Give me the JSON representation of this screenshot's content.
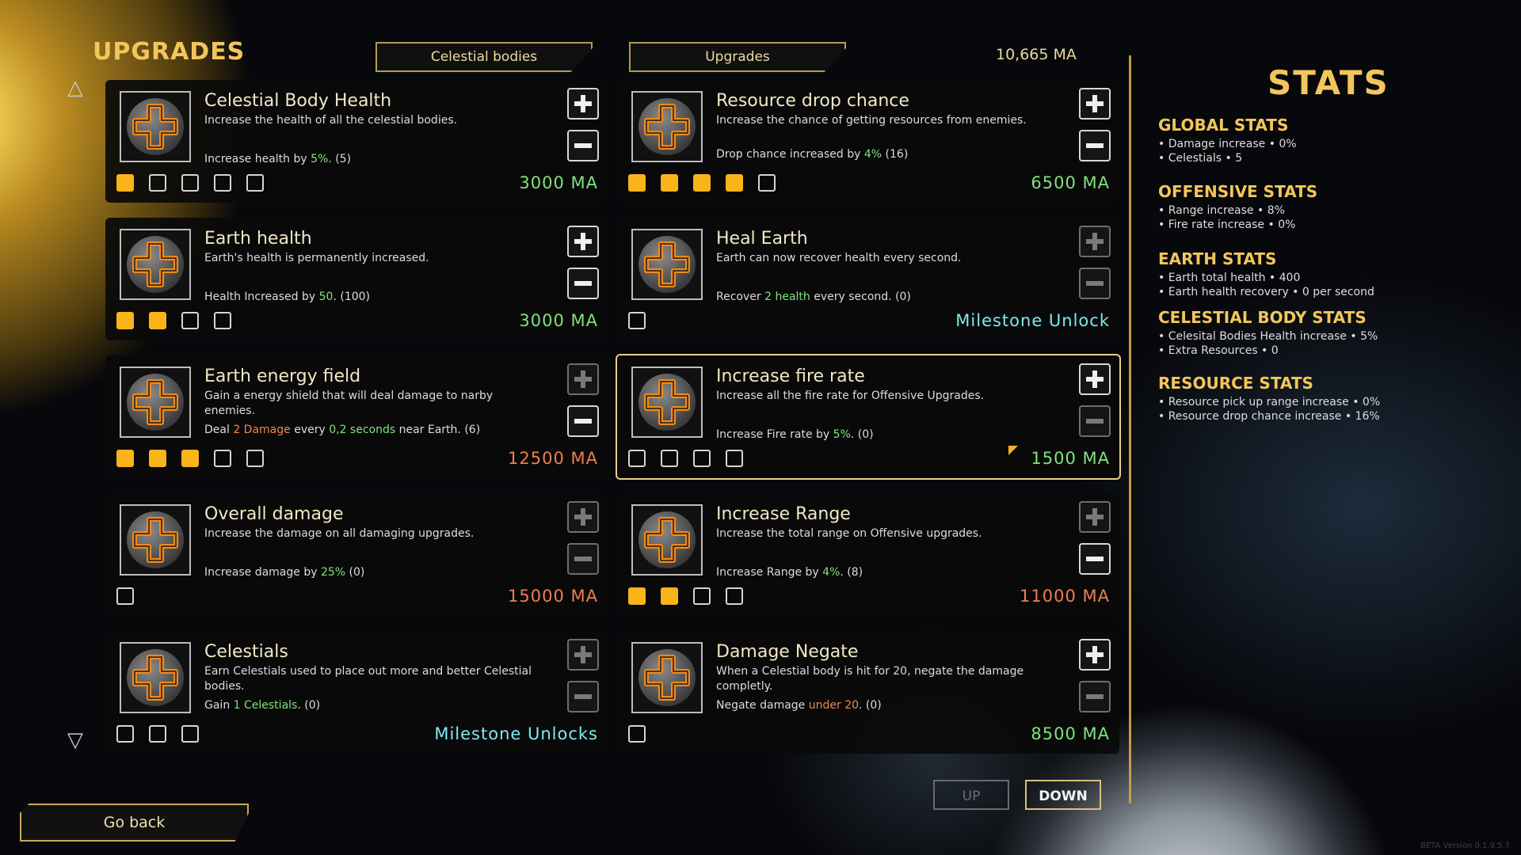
{
  "header": {
    "title": "UPGRADES",
    "tab_celestial": "Celestial bodies",
    "tab_upgrades": "Upgrades",
    "currency": "10,665 MA"
  },
  "cards": [
    {
      "name": "Celestial Body Health",
      "desc": "Increase the health of all the celestial bodies.",
      "det_pre": "Increase health by ",
      "det_hl": "5%",
      "det_post": ". (5)",
      "hl": "g",
      "filled": 1,
      "total": 5,
      "cost": "3000 MA",
      "cost_color": "green",
      "plus_dim": false,
      "minus_dim": false
    },
    {
      "name": "Resource drop chance",
      "desc": "Increase the chance of getting resources from enemies.",
      "det_pre": "Drop chance increased by ",
      "det_hl": "4%",
      "det_post": " (16)",
      "hl": "g",
      "filled": 4,
      "total": 5,
      "cost": "6500 MA",
      "cost_color": "green",
      "plus_dim": false,
      "minus_dim": false
    },
    {
      "name": "Earth health",
      "desc": "Earth's health is permanently increased.",
      "det_pre": "Health Increased by ",
      "det_hl": "50",
      "det_post": ".   (100)",
      "hl": "g",
      "filled": 2,
      "total": 4,
      "cost": "3000 MA",
      "cost_color": "green",
      "plus_dim": false,
      "minus_dim": false
    },
    {
      "name": "Heal Earth",
      "desc": "Earth can now recover health every second.",
      "det_pre": "Recover ",
      "det_hl": "2 health",
      "det_post": " every second. (0)",
      "hl": "g",
      "filled": 0,
      "total": 1,
      "cost": "Milestone Unlock",
      "cost_color": "cyan",
      "plus_dim": true,
      "minus_dim": true
    },
    {
      "name": "Earth energy field",
      "desc": "Gain a energy shield that will deal damage to narby enemies.",
      "det_pre": "Deal ",
      "det_hl": "2 Damage",
      "det_post": " every ",
      "det_hl2": "0,2 seconds",
      "det_post2": " near Earth. (6)",
      "hl": "o",
      "filled": 3,
      "total": 5,
      "cost": "12500 MA",
      "cost_color": "red",
      "plus_dim": true,
      "minus_dim": false
    },
    {
      "name": "Increase fire rate",
      "desc": "Increase all the fire rate for Offensive Upgrades.",
      "det_pre": "Increase Fire rate by ",
      "det_hl": "5%",
      "det_post": ". (0)",
      "hl": "g",
      "filled": 0,
      "total": 4,
      "cost": "1500 MA",
      "cost_color": "green",
      "plus_dim": false,
      "minus_dim": true
    },
    {
      "name": "Overall damage",
      "desc": "Increase the damage on all damaging upgrades.",
      "det_pre": "Increase damage by ",
      "det_hl": "25%",
      "det_post": " (0)",
      "hl": "g",
      "filled": 0,
      "total": 1,
      "cost": "15000 MA",
      "cost_color": "red",
      "plus_dim": true,
      "minus_dim": true
    },
    {
      "name": "Increase Range",
      "desc": "Increase the total range on Offensive upgrades.",
      "det_pre": "Increase Range by ",
      "det_hl": "4%",
      "det_post": ". (8)",
      "hl": "g",
      "filled": 2,
      "total": 4,
      "cost": "11000 MA",
      "cost_color": "red",
      "plus_dim": true,
      "minus_dim": false
    },
    {
      "name": "Celestials",
      "desc": "Earn Celestials used to place out more and better Celestial bodies.",
      "det_pre": "Gain ",
      "det_hl": "1 Celestials",
      "det_post": ". (0)",
      "hl": "g",
      "filled": 0,
      "total": 3,
      "cost": "Milestone Unlocks",
      "cost_color": "cyan",
      "plus_dim": true,
      "minus_dim": true
    },
    {
      "name": "Damage Negate",
      "desc": "When a Celestial body is hit for 20, negate the damage completly.",
      "det_pre": "Negate damage ",
      "det_hl": "under 20",
      "det_post": ". (0)",
      "hl": "o",
      "filled": 0,
      "total": 1,
      "cost": "8500 MA",
      "cost_color": "green",
      "plus_dim": false,
      "minus_dim": true
    }
  ],
  "stats": {
    "title": "STATS",
    "groups": [
      {
        "title": "GLOBAL STATS",
        "lines": [
          "• Damage increase • 0%",
          "• Celestials • 5"
        ]
      },
      {
        "title": "OFFENSIVE STATS",
        "lines": [
          "• Range increase • 8%",
          "• Fire rate increase • 0%"
        ]
      },
      {
        "title": "EARTH STATS",
        "lines": [
          "• Earth total health •  400",
          "• Earth health recovery • 0 per second"
        ]
      },
      {
        "title": "CELESTIAL BODY STATS",
        "lines": [
          "• Celesital Bodies Health increase • 5%",
          "• Extra Resources • 0"
        ]
      },
      {
        "title": "RESOURCE STATS",
        "lines": [
          "• Resource pick up range increase • 0%",
          "• Resource drop chance increase • 16%"
        ]
      }
    ]
  },
  "nav": {
    "up": "UP",
    "down": "DOWN",
    "go_back": "Go back"
  },
  "version": "BETA Version 0.1.9.5.7",
  "colors": {
    "accent": "#f3c65c",
    "filled_box": "#f8b419",
    "green": "#7fe37b",
    "red": "#f07e4f",
    "cyan": "#7ee9f0"
  }
}
